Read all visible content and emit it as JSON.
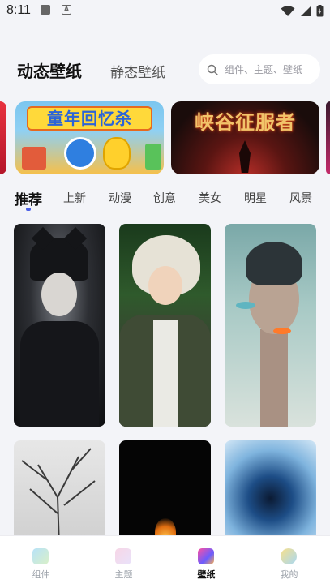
{
  "status_bar": {
    "time": "8:11",
    "notif_a_letter": "A"
  },
  "header": {
    "tab_live": "动态壁纸",
    "tab_static": "静态壁纸",
    "search_placeholder": "组件、主题、壁纸"
  },
  "banners": [
    {
      "title": "童年回忆杀"
    },
    {
      "title": "峡谷征服者"
    }
  ],
  "categories": [
    "推荐",
    "上新",
    "动漫",
    "创意",
    "美女",
    "明星",
    "风景"
  ],
  "active_category_index": 0,
  "bottom_nav": {
    "items": [
      {
        "label": "组件",
        "icon": "widget-icon"
      },
      {
        "label": "主题",
        "icon": "theme-icon"
      },
      {
        "label": "壁纸",
        "icon": "wallpaper-icon"
      },
      {
        "label": "我的",
        "icon": "profile-icon"
      }
    ],
    "active_index": 2
  },
  "colors": {
    "accent": "#4b5fe6",
    "background": "#f3f4f8"
  }
}
